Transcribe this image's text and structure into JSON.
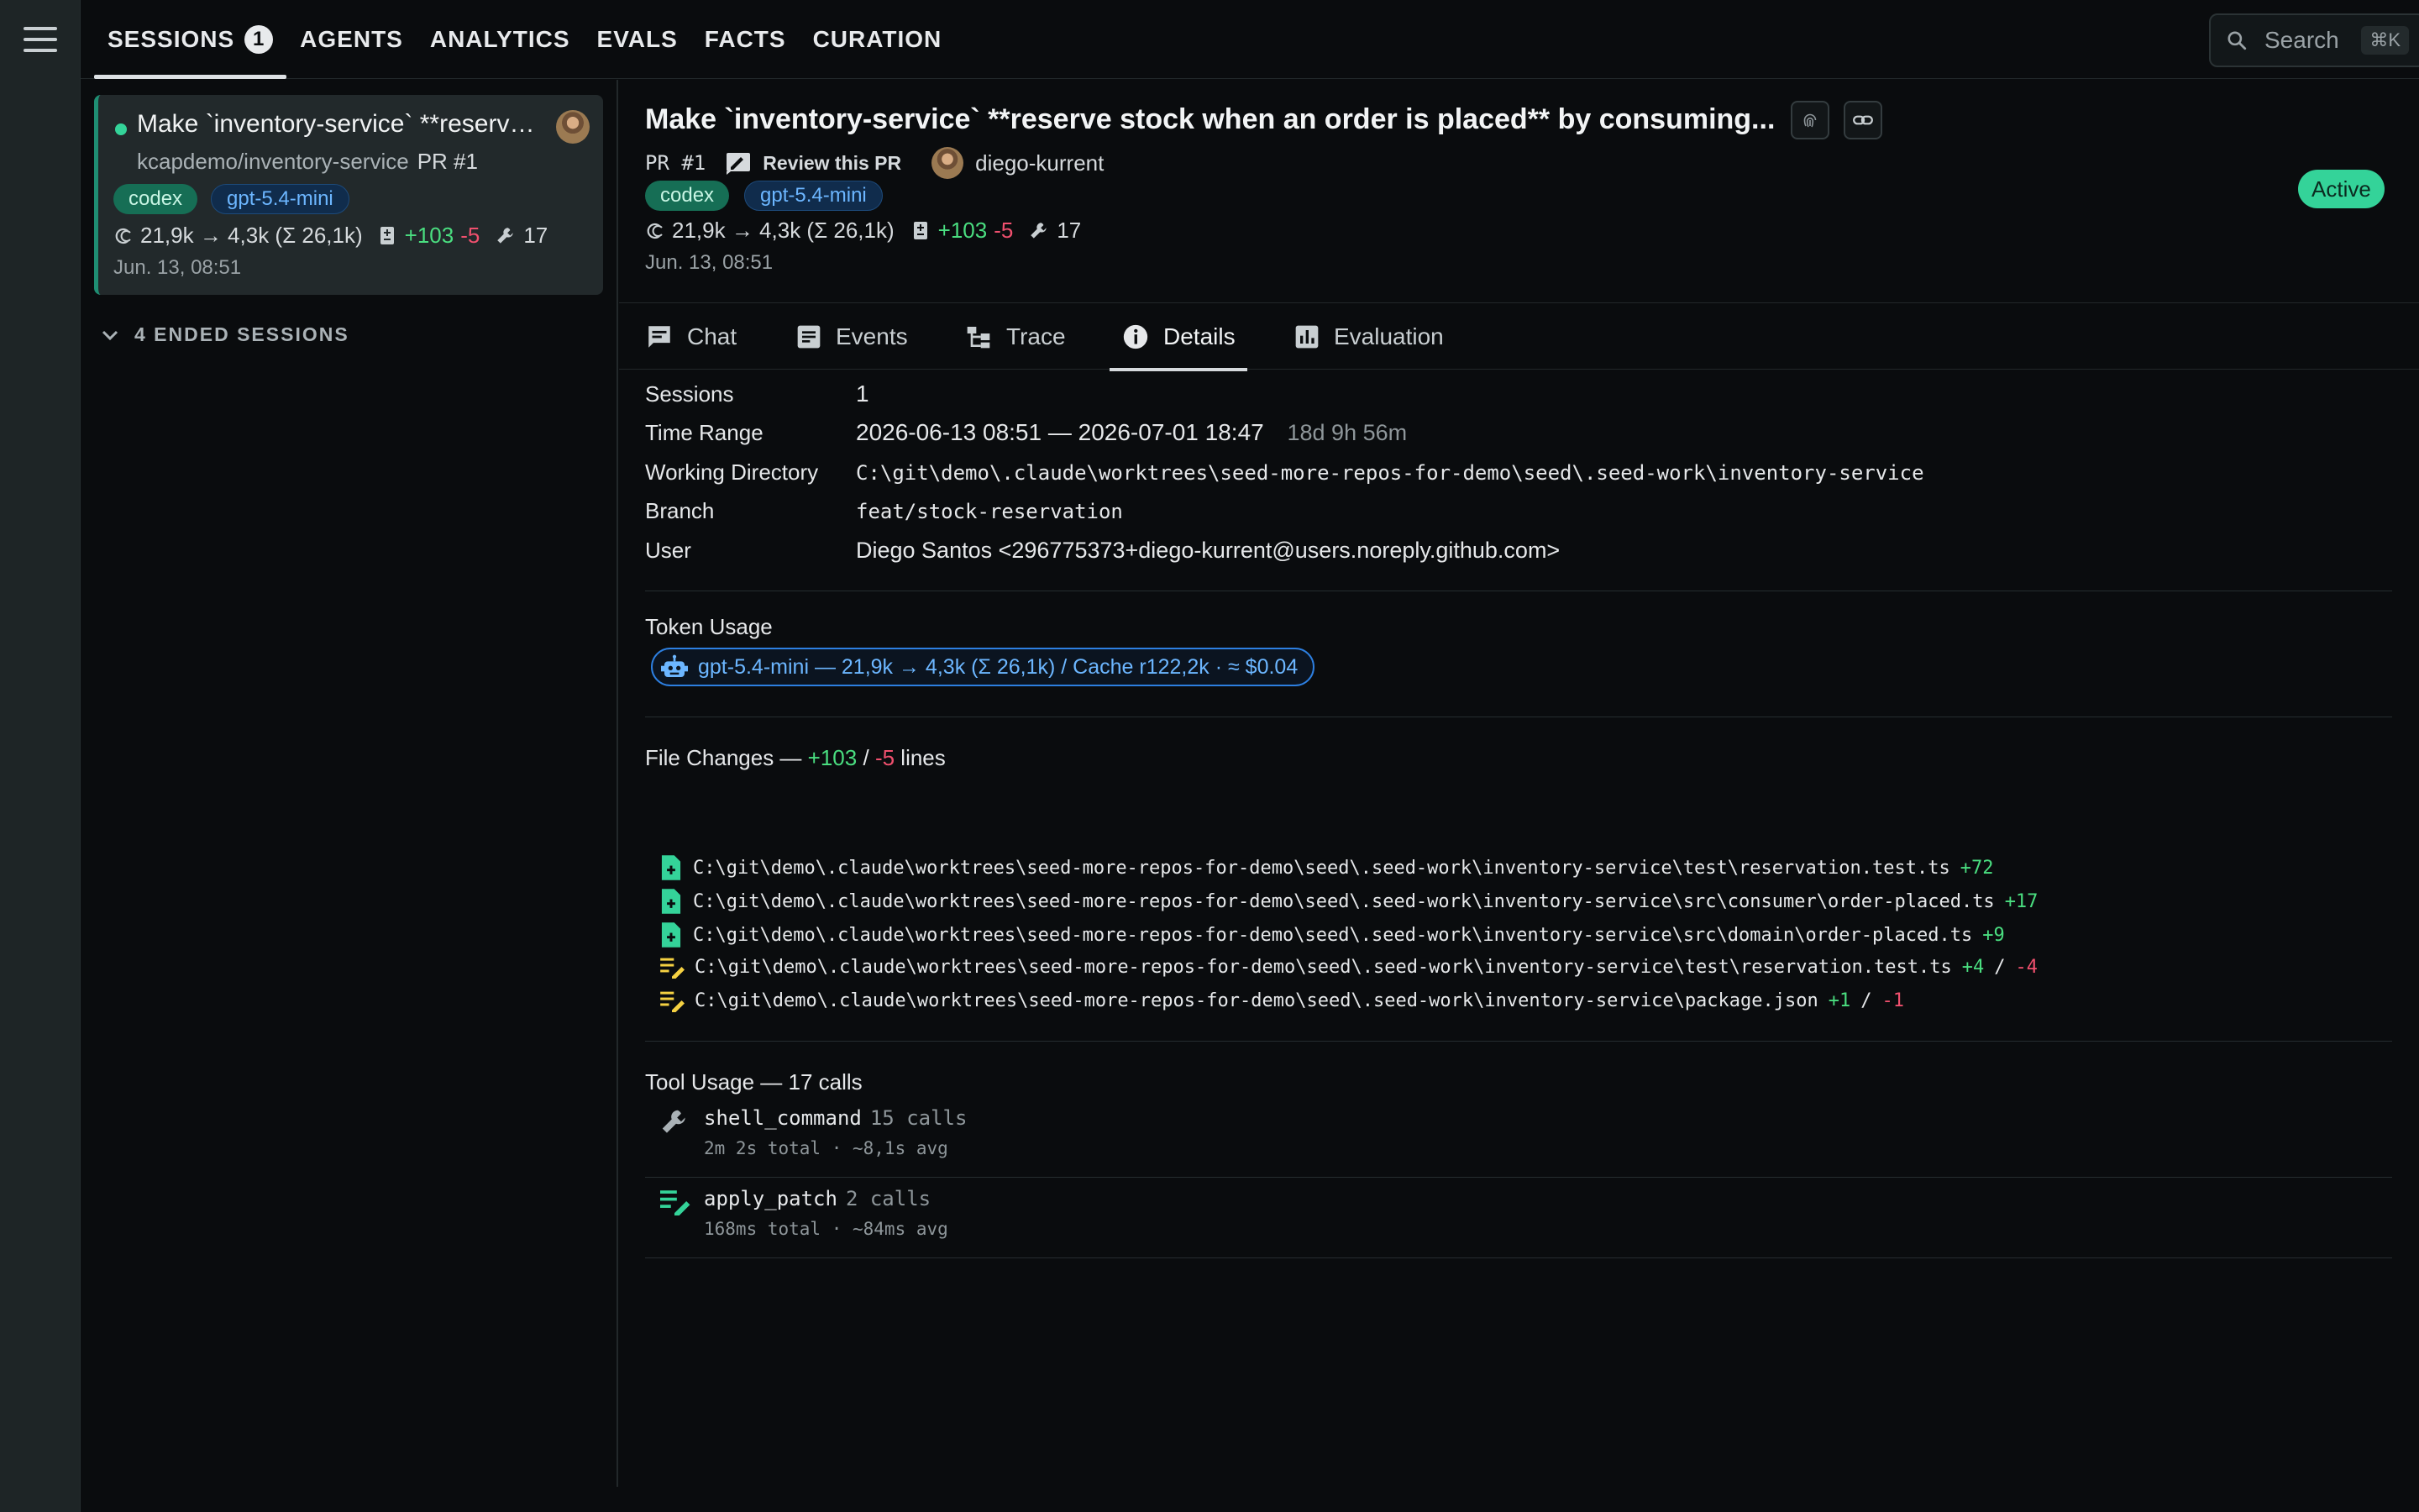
{
  "nav": {
    "tabs": [
      {
        "label": "SESSIONS",
        "badge": "1"
      },
      {
        "label": "AGENTS"
      },
      {
        "label": "ANALYTICS"
      },
      {
        "label": "EVALS"
      },
      {
        "label": "FACTS"
      },
      {
        "label": "CURATION"
      }
    ],
    "search_placeholder": "Search",
    "search_shortcut": "⌘K"
  },
  "sidebar": {
    "session": {
      "title": "Make `inventory-service` **reserve stock when an order is placed** by consuming...",
      "repo": "kcapdemo/inventory-service",
      "pr": "PR #1",
      "tags": [
        "codex",
        "gpt-5.4-mini"
      ],
      "tokens": "21,9k → 4,3k (Σ 26,1k)",
      "added": "+103",
      "removed": "-5",
      "tool_calls": "17",
      "date": "Jun. 13, 08:51"
    },
    "ended_label": "4 ENDED SESSIONS"
  },
  "session": {
    "title": "Make `inventory-service` **reserve stock when an order is placed** by consuming...",
    "pr": "PR #1",
    "review_label": "Review this PR",
    "author": "diego-kurrent",
    "tags": [
      "codex",
      "gpt-5.4-mini"
    ],
    "tokens": "21,9k → 4,3k (Σ 26,1k)",
    "added": "+103",
    "removed": "-5",
    "tool_calls": "17",
    "date": "Jun. 13, 08:51",
    "status": "Active"
  },
  "tabs": [
    "Chat",
    "Events",
    "Trace",
    "Details",
    "Evaluation"
  ],
  "details": {
    "sessions_label": "Sessions",
    "sessions_value": "1",
    "time_range_label": "Time Range",
    "time_range_value": "2026-06-13 08:51 — 2026-07-01 18:47",
    "time_range_duration": "18d 9h 56m",
    "working_dir_label": "Working Directory",
    "working_dir_value": "C:\\git\\demo\\.claude\\worktrees\\seed-more-repos-for-demo\\seed\\.seed-work\\inventory-service",
    "branch_label": "Branch",
    "branch_value": "feat/stock-reservation",
    "user_label": "User",
    "user_value": "Diego Santos <296775373+diego-kurrent@users.noreply.github.com>"
  },
  "token_usage": {
    "heading": "Token Usage",
    "pill": "gpt-5.4-mini — 21,9k → 4,3k (Σ 26,1k) / Cache r122,2k · ≈ $0.04"
  },
  "file_changes": {
    "heading_prefix": "File Changes —",
    "added": "+103",
    "sep": "/",
    "removed": "-5",
    "suffix": "lines",
    "files": [
      {
        "kind": "new",
        "path": "C:\\git\\demo\\.claude\\worktrees\\seed-more-repos-for-demo\\seed\\.seed-work\\inventory-service\\test\\reservation.test.ts",
        "added": "+72",
        "removed": ""
      },
      {
        "kind": "new",
        "path": "C:\\git\\demo\\.claude\\worktrees\\seed-more-repos-for-demo\\seed\\.seed-work\\inventory-service\\src\\consumer\\order-placed.ts",
        "added": "+17",
        "removed": ""
      },
      {
        "kind": "new",
        "path": "C:\\git\\demo\\.claude\\worktrees\\seed-more-repos-for-demo\\seed\\.seed-work\\inventory-service\\src\\domain\\order-placed.ts",
        "added": "+9",
        "removed": ""
      },
      {
        "kind": "edit",
        "path": "C:\\git\\demo\\.claude\\worktrees\\seed-more-repos-for-demo\\seed\\.seed-work\\inventory-service\\test\\reservation.test.ts",
        "added": "+4",
        "removed": "-4"
      },
      {
        "kind": "edit",
        "path": "C:\\git\\demo\\.claude\\worktrees\\seed-more-repos-for-demo\\seed\\.seed-work\\inventory-service\\package.json",
        "added": "+1",
        "removed": "-1"
      }
    ]
  },
  "tool_usage": {
    "heading": "Tool Usage — 17 calls",
    "tools": [
      {
        "icon": "wrench-icon",
        "name": "shell_command",
        "calls": "15 calls",
        "meta": "2m 2s total · ~8,1s avg"
      },
      {
        "icon": "edit-list-icon",
        "name": "apply_patch",
        "calls": "2 calls",
        "meta": "168ms total · ~84ms avg"
      }
    ]
  },
  "colors": {
    "accent_green": "#34d399",
    "added": "#4ade80",
    "removed": "#f0506e",
    "model_blue": "#6cb6ff"
  }
}
